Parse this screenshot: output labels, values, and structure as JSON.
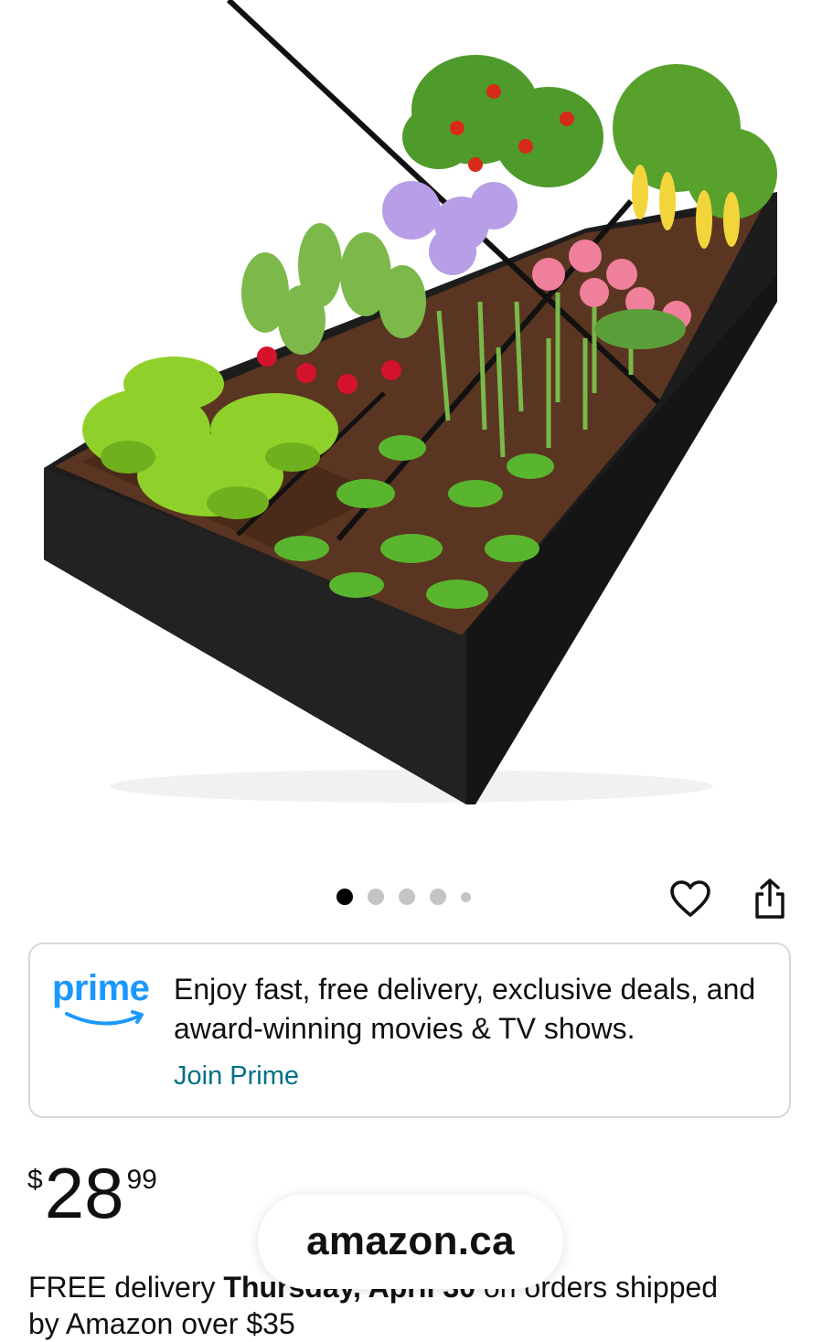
{
  "carousel": {
    "total": 5,
    "active": 1
  },
  "actions": {
    "heart_icon": "heart-icon",
    "share_icon": "share-icon"
  },
  "prime_card": {
    "logo_text": "prime",
    "description": "Enjoy fast, free delivery, exclusive deals, and award-winning movies & TV shows.",
    "join_link": "Join Prime"
  },
  "price": {
    "symbol": "$",
    "whole": "28",
    "fraction": "99"
  },
  "delivery": {
    "prefix": "FREE delivery ",
    "date": "Thursday, April 30",
    "suffix": " on orders shipped",
    "line2": "by Amazon over $35"
  },
  "browser": {
    "domain": "amazon.ca"
  },
  "colors": {
    "prime_blue": "#1a98ff",
    "link": "#007185",
    "text": "#0f1111",
    "card_border": "#d5d9d9"
  }
}
